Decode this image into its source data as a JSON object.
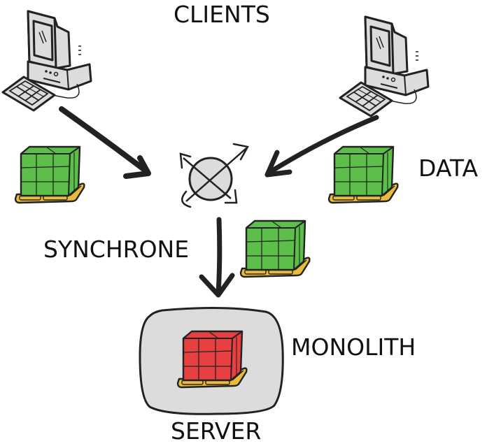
{
  "diagram": {
    "title_top": "CLIENTS",
    "labels": {
      "clients": "CLIENTS",
      "data": "DATA",
      "synchrone": "SYNCHRONE",
      "monolith": "MONOLITH",
      "server": "SERVER"
    },
    "nodes": [
      {
        "id": "client-left",
        "type": "computer",
        "role": "client"
      },
      {
        "id": "client-right",
        "type": "computer",
        "role": "client"
      },
      {
        "id": "hub",
        "type": "sync-hub",
        "symbol": "circle-with-x"
      },
      {
        "id": "data-left",
        "type": "data-package",
        "color": "green"
      },
      {
        "id": "data-right",
        "type": "data-package",
        "color": "green"
      },
      {
        "id": "data-middle",
        "type": "data-package",
        "color": "green"
      },
      {
        "id": "server",
        "type": "server",
        "contains": "monolith-package"
      },
      {
        "id": "monolith-package",
        "type": "data-package",
        "color": "red"
      }
    ],
    "edges": [
      {
        "from": "client-left",
        "to": "hub"
      },
      {
        "from": "client-right",
        "to": "hub"
      },
      {
        "from": "hub",
        "to": "server",
        "label": "SYNCHRONE"
      }
    ],
    "colors": {
      "data_package": "#5cbf4a",
      "monolith_package": "#e84040",
      "pallet": "#e8bb3a",
      "device_fill": "#dcdcdc",
      "server_fill": "#dcdcdc",
      "ink": "#222222"
    }
  }
}
